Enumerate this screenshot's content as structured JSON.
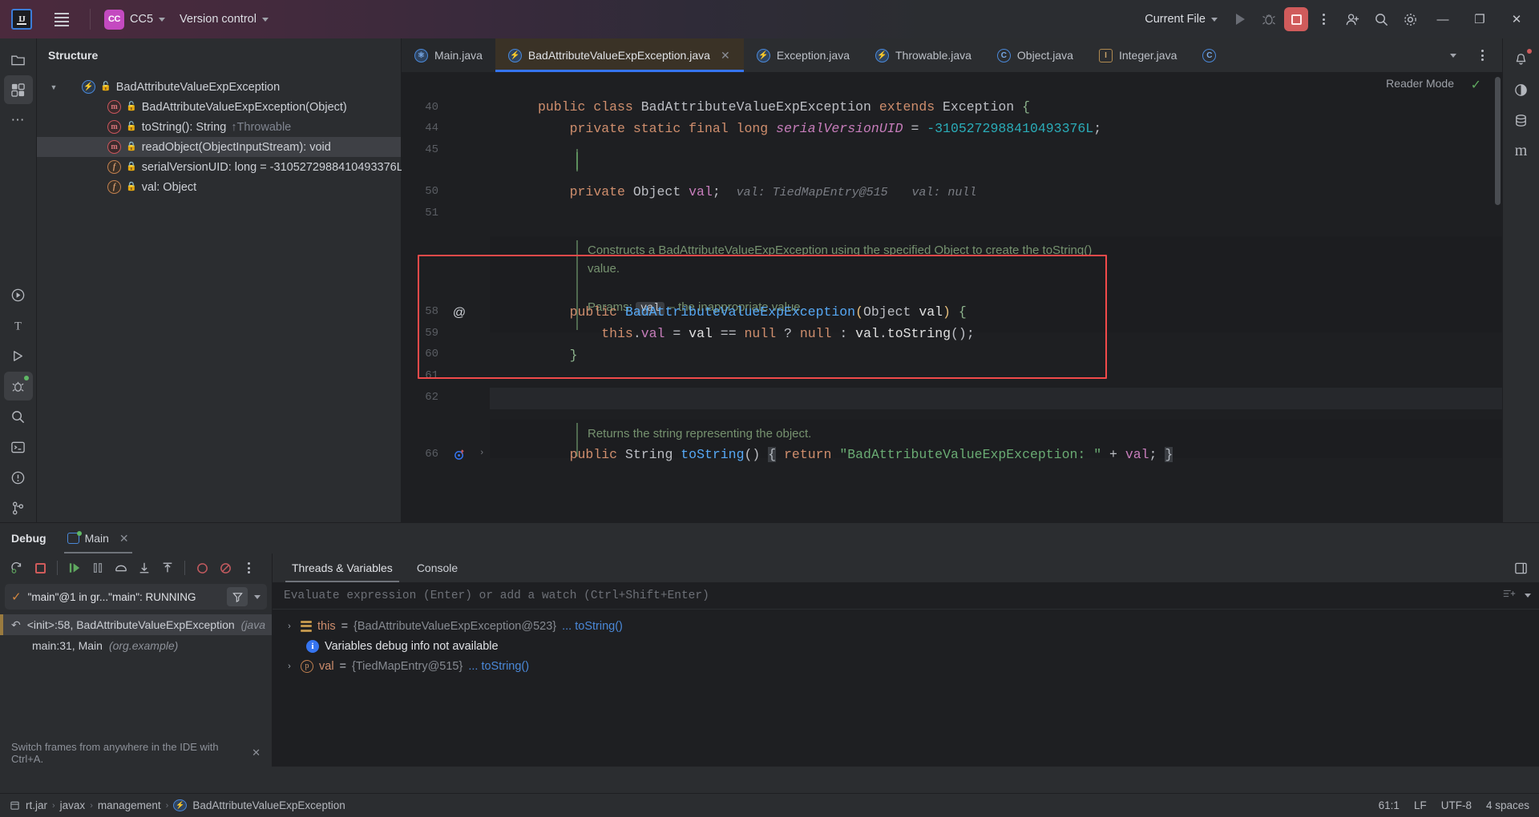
{
  "header": {
    "logo": "IJ",
    "menu_icon": "hamburger-icon",
    "project_badge": "CC",
    "project_name": "CC5",
    "vcs_label": "Version control",
    "run_config": "Current File",
    "run_icon": "run-icon",
    "debug_icon": "debug-icon",
    "stop_icon": "stop-icon",
    "more_icon": "more-vertical-icon",
    "account_icon": "account-icon",
    "search_icon": "search-icon",
    "settings_icon": "settings-icon",
    "minimize": "—",
    "maximize": "❐",
    "close": "✕"
  },
  "left_rail": [
    {
      "name": "project-icon",
      "glyph": "▢"
    },
    {
      "name": "structure-icon",
      "glyph": "⊞"
    },
    {
      "name": "more-tools-icon",
      "glyph": "⋯"
    },
    {
      "name": "run-icon",
      "glyph": "▷"
    },
    {
      "name": "terminal-type-icon",
      "glyph": "T"
    },
    {
      "name": "run-tool-icon",
      "glyph": "▷"
    },
    {
      "name": "debug-tool-icon",
      "glyph": "✦"
    },
    {
      "name": "search-everywhere-icon",
      "glyph": "⌕"
    },
    {
      "name": "terminal-icon",
      "glyph": "⬚"
    },
    {
      "name": "problems-icon",
      "glyph": "ⓘ"
    },
    {
      "name": "version-control-icon",
      "glyph": "⑂"
    }
  ],
  "right_rail": [
    {
      "name": "notifications-icon",
      "glyph": "ὑ4"
    },
    {
      "name": "ai-assistant-icon",
      "glyph": "◑"
    },
    {
      "name": "database-icon",
      "glyph": "⛃"
    },
    {
      "name": "maven-icon",
      "glyph": "m"
    }
  ],
  "structure": {
    "title": "Structure",
    "items": [
      {
        "label": "BadAttributeValueExpException",
        "kind": "class",
        "lock": "green",
        "expanded": true,
        "indent": 0,
        "selected": false,
        "suffix": ""
      },
      {
        "label": "BadAttributeValueExpException(Object)",
        "kind": "method",
        "lock": "green",
        "indent": 1,
        "selected": false,
        "suffix": ""
      },
      {
        "label": "toString(): String",
        "kind": "method",
        "lock": "green",
        "indent": 1,
        "selected": false,
        "suffix": "↑Throwable"
      },
      {
        "label": "readObject(ObjectInputStream): void",
        "kind": "method",
        "lock": "red",
        "indent": 1,
        "selected": true,
        "suffix": ""
      },
      {
        "label": "serialVersionUID: long = -3105272988410493376L",
        "kind": "field-static",
        "lock": "red",
        "indent": 1,
        "selected": false,
        "suffix": ""
      },
      {
        "label": "val: Object",
        "kind": "field",
        "lock": "red",
        "indent": 1,
        "selected": false,
        "suffix": ""
      }
    ]
  },
  "editor": {
    "tabs": [
      {
        "label": "Main.java",
        "icon": "run-class-icon",
        "active": false,
        "closable": false
      },
      {
        "label": "BadAttributeValueExpException.java",
        "icon": "exception-class-icon",
        "active": true,
        "closable": true
      },
      {
        "label": "Exception.java",
        "icon": "exception-class-icon",
        "active": false,
        "closable": false
      },
      {
        "label": "Throwable.java",
        "icon": "exception-class-icon",
        "active": false,
        "closable": false
      },
      {
        "label": "Object.java",
        "icon": "class-icon",
        "active": false,
        "closable": false
      },
      {
        "label": "Integer.java",
        "icon": "interface-icon",
        "active": false,
        "closable": false
      },
      {
        "label": "",
        "icon": "class-icon",
        "active": false,
        "closable": false
      }
    ],
    "tab_overflow_icon": "chevron-down-icon",
    "tab_more_icon": "more-vertical-icon",
    "reader_mode": "Reader Mode",
    "inspection_ok": "✓",
    "lines": [
      {
        "num": "40",
        "type": "code",
        "text": "public class BadAttributeValueExpException extends Exception {"
      },
      {
        "num": "44",
        "type": "code",
        "text": "    private static final long serialVersionUID = -3105272988410493376L;"
      },
      {
        "num": "45",
        "type": "blank",
        "text": ""
      },
      {
        "num": "50",
        "type": "code",
        "text": "    private Object val;",
        "inlay1": "val: TiedMapEntry@515",
        "inlay2": "val: null"
      },
      {
        "num": "51",
        "type": "blank",
        "text": ""
      },
      {
        "num": "",
        "type": "doc",
        "text": "Constructs a BadAttributeValueExpException using the specified Object to create the toString()"
      },
      {
        "num": "",
        "type": "doc",
        "text": "value."
      },
      {
        "num": "",
        "type": "docparam",
        "prefix": "Params:",
        "chip": "val",
        "suffix": "– the inappropriate value."
      },
      {
        "num": "58",
        "type": "code-hl",
        "text": "    public BadAttributeValueExpException(Object val) {",
        "gutter_icon": "annotation-override-icon"
      },
      {
        "num": "59",
        "type": "code",
        "text": "        this.val = val == null ? null : val.toString();"
      },
      {
        "num": "60",
        "type": "code",
        "text": "    }"
      },
      {
        "num": "61",
        "type": "blank-current",
        "text": ""
      },
      {
        "num": "62",
        "type": "blank",
        "text": ""
      },
      {
        "num": "",
        "type": "doc",
        "text": "Returns the string representing the object."
      },
      {
        "num": "66",
        "type": "code",
        "text": "    public String toString() { return \"BadAttributeValueExpException: \" + val; }",
        "gutter_icon": "implements-icon",
        "gutter_fold": "›"
      }
    ]
  },
  "debug": {
    "panel_title": "Debug",
    "session_tab": "Main",
    "session_close": "✕",
    "toolbar": [
      {
        "name": "rerun-button",
        "glyph": "⟳"
      },
      {
        "name": "stop-button",
        "glyph": "■"
      },
      {
        "name": "resume-button",
        "glyph": "▶"
      },
      {
        "name": "pause-button",
        "glyph": "‖"
      },
      {
        "name": "step-over-button",
        "glyph": "⌒"
      },
      {
        "name": "step-into-button",
        "glyph": "↓"
      },
      {
        "name": "step-out-button",
        "glyph": "↑"
      },
      {
        "name": "mute-breakpoints-button",
        "glyph": "○"
      },
      {
        "name": "view-breakpoints-button",
        "glyph": "⊘"
      },
      {
        "name": "more-options-button",
        "glyph": "⋮"
      }
    ],
    "thread_status": "\"main\"@1 in gr...\"main\": RUNNING",
    "thread_filter_icon": "filter-icon",
    "thread_dropdown_icon": "chevron-down-icon",
    "frames": [
      {
        "label": "<init>:58, BadAttributeValueExpException",
        "module": "(java",
        "selected": true
      },
      {
        "label": "main:31, Main",
        "module": "(org.example)",
        "selected": false
      }
    ],
    "hint": "Switch frames from anywhere in the IDE with Ctrl+A.",
    "hint_close": "✕",
    "right_tabs": [
      {
        "label": "Threads & Variables",
        "active": true
      },
      {
        "label": "Console",
        "active": false
      }
    ],
    "layout_icon": "layout-settings-icon",
    "evaluate_placeholder": "Evaluate expression (Enter) or add a watch (Ctrl+Shift+Enter)",
    "evaluate_add_icon": "add-watch-icon",
    "evaluate_expand_icon": "chevron-down-icon",
    "variables": [
      {
        "arrow": "›",
        "icon": "object-stack-icon",
        "name": "this",
        "eq": "=",
        "value": "{BadAttributeValueExpException@523}",
        "link": "... toString()"
      },
      {
        "arrow": "",
        "icon": "info-icon",
        "name": "",
        "eq": "",
        "value": "Variables debug info not available",
        "link": "",
        "info": true
      },
      {
        "arrow": "›",
        "icon": "parameter-icon",
        "name": "val",
        "eq": "=",
        "value": "{TiedMapEntry@515}",
        "link": "... toString()"
      }
    ]
  },
  "status_bar": {
    "breadcrumbs": [
      {
        "label": "rt.jar",
        "icon": "jar-icon"
      },
      {
        "label": "javax",
        "icon": ""
      },
      {
        "label": "management",
        "icon": ""
      },
      {
        "label": "BadAttributeValueExpException",
        "icon": "exception-class-icon"
      }
    ],
    "separator": "›",
    "caret_position": "61:1",
    "line_separator": "LF",
    "encoding": "UTF-8",
    "indent": "4 spaces"
  },
  "colors": {
    "accent": "#3574f0",
    "highlight": "#2f5bb0",
    "red_box": "#f24a4a",
    "brand_magenta": "#c44ac0"
  }
}
